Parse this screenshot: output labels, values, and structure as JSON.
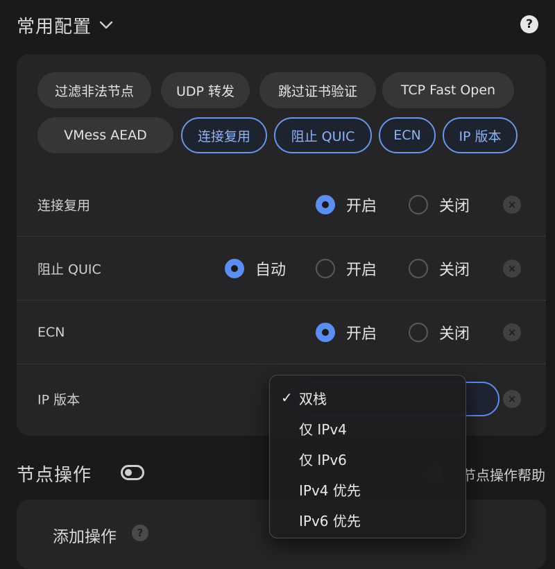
{
  "header": {
    "title": "常用配置",
    "help": "?"
  },
  "chips": [
    {
      "label": "过滤非法节点",
      "active": false
    },
    {
      "label": "UDP 转发",
      "active": false
    },
    {
      "label": "跳过证书验证",
      "active": false
    },
    {
      "label": "TCP Fast Open",
      "active": false
    },
    {
      "label": "VMess AEAD",
      "active": false
    },
    {
      "label": "连接复用",
      "active": true
    },
    {
      "label": "阻止 QUIC",
      "active": true
    },
    {
      "label": "ECN",
      "active": true
    },
    {
      "label": "IP 版本",
      "active": true
    }
  ],
  "rows": [
    {
      "label": "连接复用",
      "options": [
        {
          "label": "开启",
          "selected": true
        },
        {
          "label": "关闭",
          "selected": false
        }
      ]
    },
    {
      "label": "阻止 QUIC",
      "options": [
        {
          "label": "自动",
          "selected": true
        },
        {
          "label": "开启",
          "selected": false
        },
        {
          "label": "关闭",
          "selected": false
        }
      ]
    },
    {
      "label": "ECN",
      "options": [
        {
          "label": "开启",
          "selected": true
        },
        {
          "label": "关闭",
          "selected": false
        }
      ]
    },
    {
      "label": "IP 版本"
    }
  ],
  "remove_symbol": "×",
  "dropdown": {
    "check": "✓",
    "items": [
      {
        "label": "双栈",
        "selected": true
      },
      {
        "label": "仅 IPv4",
        "selected": false
      },
      {
        "label": "仅 IPv6",
        "selected": false
      },
      {
        "label": "IPv4 优先",
        "selected": false
      },
      {
        "label": "IPv6 优先",
        "selected": false
      }
    ]
  },
  "section2": {
    "title": "节点操作",
    "help_text": "节点操作帮助"
  },
  "card2": {
    "title": "添加操作",
    "help": "?"
  },
  "colors": {
    "accent": "#5b8ef0",
    "background": "#1a1a1c",
    "card": "#252527"
  }
}
